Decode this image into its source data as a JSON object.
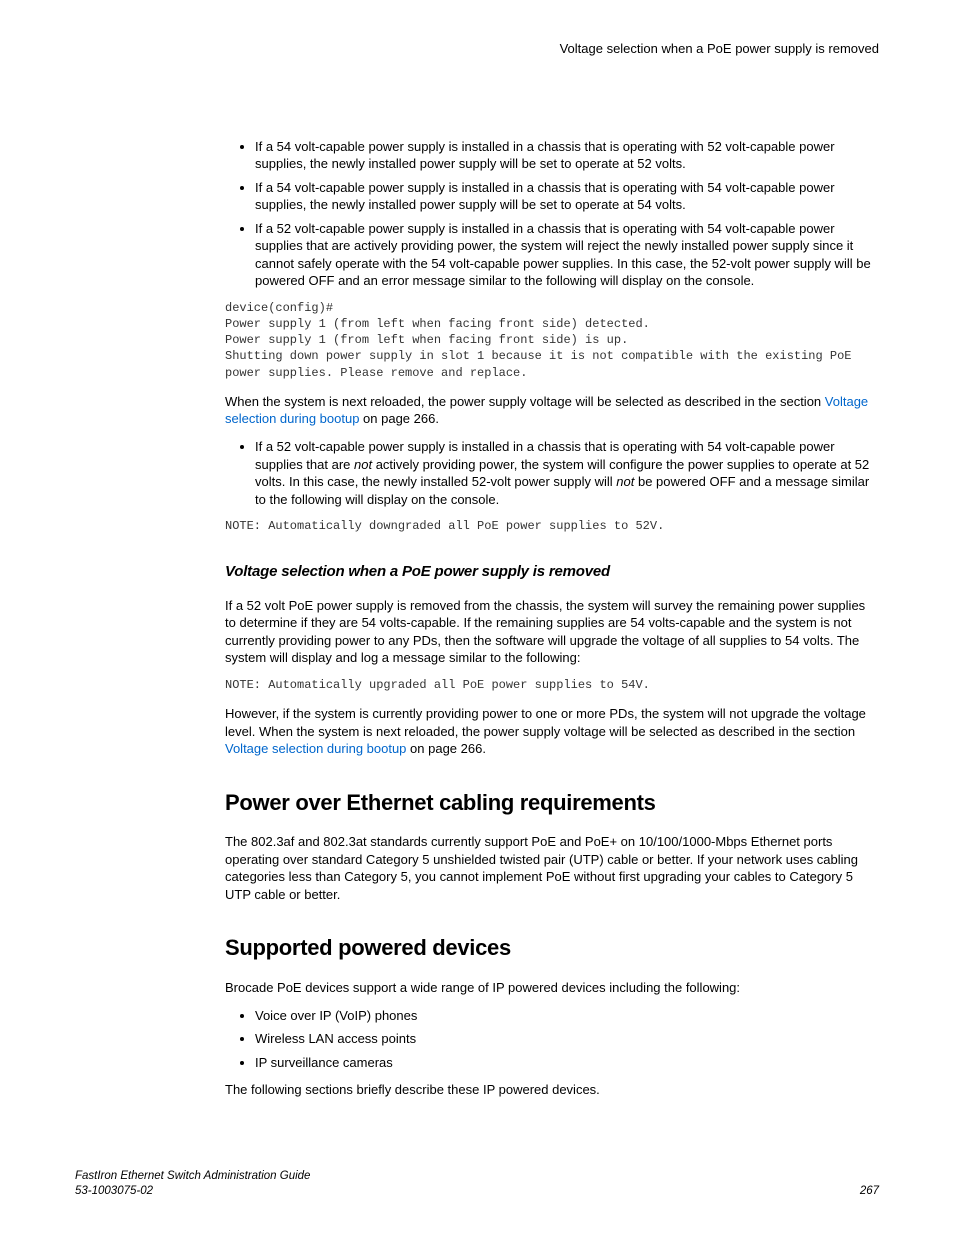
{
  "header": {
    "title": "Voltage selection when a PoE power supply is removed"
  },
  "bullets1": [
    "If a 54 volt-capable power supply is installed in a chassis that is operating with 52 volt-capable power supplies, the newly installed power supply will be set to operate at 52 volts.",
    "If a 54 volt-capable power supply is installed in a chassis that is operating with 54 volt-capable power supplies, the newly installed power supply will be set to operate at 54 volts.",
    "If a 52 volt-capable power supply is installed in a chassis that is operating with 54 volt-capable power supplies that are actively providing power, the system will reject the newly installed power supply since it cannot safely operate with the 54 volt-capable power supplies. In this case, the 52-volt power supply will be powered OFF and an error message similar to the following will display on the console."
  ],
  "code1": "device(config)#\nPower supply 1 (from left when facing front side) detected.\nPower supply 1 (from left when facing front side) is up.\nShutting down power supply in slot 1 because it is not compatible with the existing PoE power supplies. Please remove and replace.",
  "para_post_code1_a": "When the system is next reloaded, the power supply voltage will be selected as described in the section ",
  "link1": "Voltage selection during bootup",
  "para_post_code1_b": " on page 266.",
  "bullet2_a": "If a 52 volt-capable power supply is installed in a chassis that is operating with 54 volt-capable power supplies that are ",
  "bullet2_not1": "not",
  "bullet2_b": " actively providing power, the system will configure the power supplies to operate at 52 volts. In this case, the newly installed 52-volt power supply will ",
  "bullet2_not2": "not",
  "bullet2_c": " be powered OFF and a message similar to the following will display on the console.",
  "code2": "NOTE: Automatically downgraded all PoE power supplies to 52V.",
  "section_sub": "Voltage selection when a PoE power supply is removed",
  "para_removed": "If a 52 volt PoE power supply is removed from the chassis, the system will survey the remaining power supplies to determine if they are 54 volts-capable. If the remaining supplies are 54 volts-capable and the system is not currently providing power to any PDs, then the software will upgrade the voltage of all supplies to 54 volts. The system will display and log a message similar to the following:",
  "code3": "NOTE: Automatically upgraded all PoE power supplies to 54V.",
  "para_however_a": "However, if the system is currently providing power to one or more PDs, the system will not upgrade the voltage level. When the system is next reloaded, the power supply voltage will be selected as described in the section ",
  "link2": "Voltage selection during bootup",
  "para_however_b": " on page 266.",
  "section_cabling": {
    "title": "Power over Ethernet cabling requirements",
    "body": "The 802.3af and 802.3at standards currently support PoE and PoE+ on 10/100/1000-Mbps Ethernet ports operating over standard Category 5 unshielded twisted pair (UTP) cable or better. If your network uses cabling categories less than Category 5, you cannot implement PoE without first upgrading your cables to Category 5 UTP cable or better."
  },
  "section_devices": {
    "title": "Supported powered devices",
    "intro": "Brocade PoE devices support a wide range of IP powered devices including the following:",
    "items": [
      "Voice over IP (VoIP) phones",
      "Wireless LAN access points",
      "IP surveillance cameras"
    ],
    "outro": "The following sections briefly describe these IP powered devices."
  },
  "footer": {
    "title": "FastIron Ethernet Switch Administration Guide",
    "docnum": "53-1003075-02",
    "page": "267"
  }
}
